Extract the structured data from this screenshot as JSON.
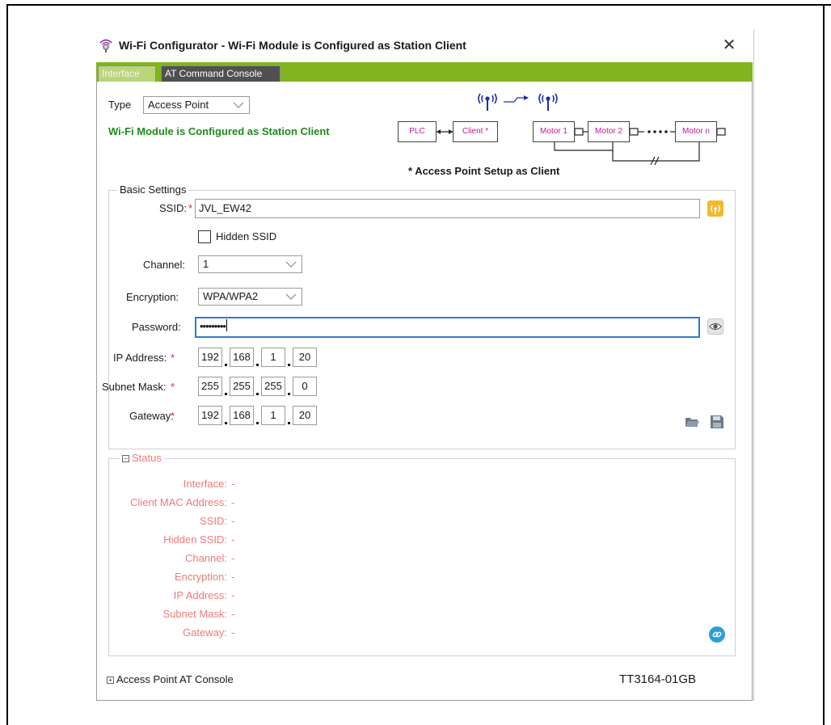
{
  "window": {
    "title": "Wi-Fi Configurator - Wi-Fi Module is Configured as Station Client",
    "close_symbol": "✕",
    "app_icon": "wifi-configurator-icon"
  },
  "tabs": [
    {
      "label": "Interface",
      "active": true
    },
    {
      "label": "AT Command Console",
      "active": false
    }
  ],
  "type_row": {
    "label": "Type",
    "value": "Access Point"
  },
  "configured_message": "Wi-Fi Module is Configured as Station Client",
  "diagram": {
    "plc": "PLC",
    "client": "Client *",
    "motor1": "Motor 1",
    "motor2": "Motor 2",
    "motorn": "Motor n",
    "note": "* Access Point Setup as Client"
  },
  "basic_settings": {
    "legend": "Basic Settings",
    "ssid_label": "SSID:",
    "ssid_value": "JVL_EW42",
    "hidden_ssid_label": "Hidden SSID",
    "hidden_ssid_checked": false,
    "channel_label": "Channel:",
    "channel_value": "1",
    "encryption_label": "Encryption:",
    "encryption_value": "WPA/WPA2",
    "password_label": "Password:",
    "password_value": "•••••••••",
    "ip_label": "IP Address:",
    "ip": [
      "192",
      "168",
      "1",
      "20"
    ],
    "subnet_label": "Subnet Mask:",
    "subnet": [
      "255",
      "255",
      "255",
      "0"
    ],
    "gateway_label": "Gateway:",
    "gateway": [
      "192",
      "168",
      "1",
      "20"
    ],
    "required_marker": "*"
  },
  "status": {
    "legend": "Status",
    "expander": "−",
    "rows": [
      {
        "label": "Interface:",
        "value": "-"
      },
      {
        "label": "Client MAC Address:",
        "value": "-"
      },
      {
        "label": "SSID:",
        "value": "-"
      },
      {
        "label": "Hidden SSID:",
        "value": "-"
      },
      {
        "label": "Channel:",
        "value": "-"
      },
      {
        "label": "Encryption:",
        "value": "-"
      },
      {
        "label": "IP Address:",
        "value": "-"
      },
      {
        "label": "Subnet Mask:",
        "value": "-"
      },
      {
        "label": "Gateway:",
        "value": "-"
      }
    ]
  },
  "footer": {
    "expander": "+",
    "console_label": "Access Point AT Console",
    "code": "TT3164-01GB"
  },
  "colors": {
    "tab_strip": "#80b51e",
    "success_text": "#1f8a1f",
    "required": "#e2282a",
    "status_text": "#f07a7a",
    "focus": "#2f7bd6",
    "diagram_text": "#c51c8e",
    "diagram_antenna": "#1c2fa8"
  }
}
